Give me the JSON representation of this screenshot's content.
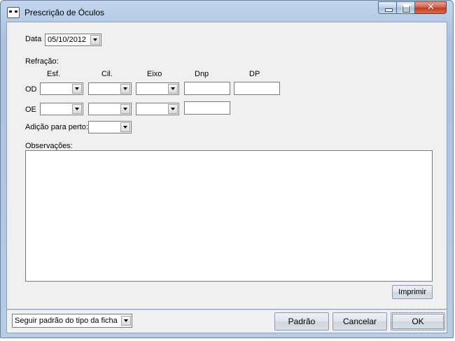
{
  "window": {
    "title": "Prescrição de Óculos"
  },
  "form": {
    "date_label": "Data",
    "date_value": "05/10/2012",
    "refraction_label": "Refração:",
    "columns": {
      "esf": "Esf.",
      "cil": "Cil.",
      "eixo": "Eixo",
      "dnp": "Dnp",
      "dp": "DP"
    },
    "rows": {
      "od": "OD",
      "oe": "OE"
    },
    "addition_label": "Adição para perto:",
    "observations_label": "Observações:",
    "observations_value": "",
    "print_button": "Imprimir"
  },
  "footer": {
    "mode_select": "Seguir padrão do tipo da ficha",
    "default_button": "Padrão",
    "cancel_button": "Cancelar",
    "ok_button": "OK"
  }
}
